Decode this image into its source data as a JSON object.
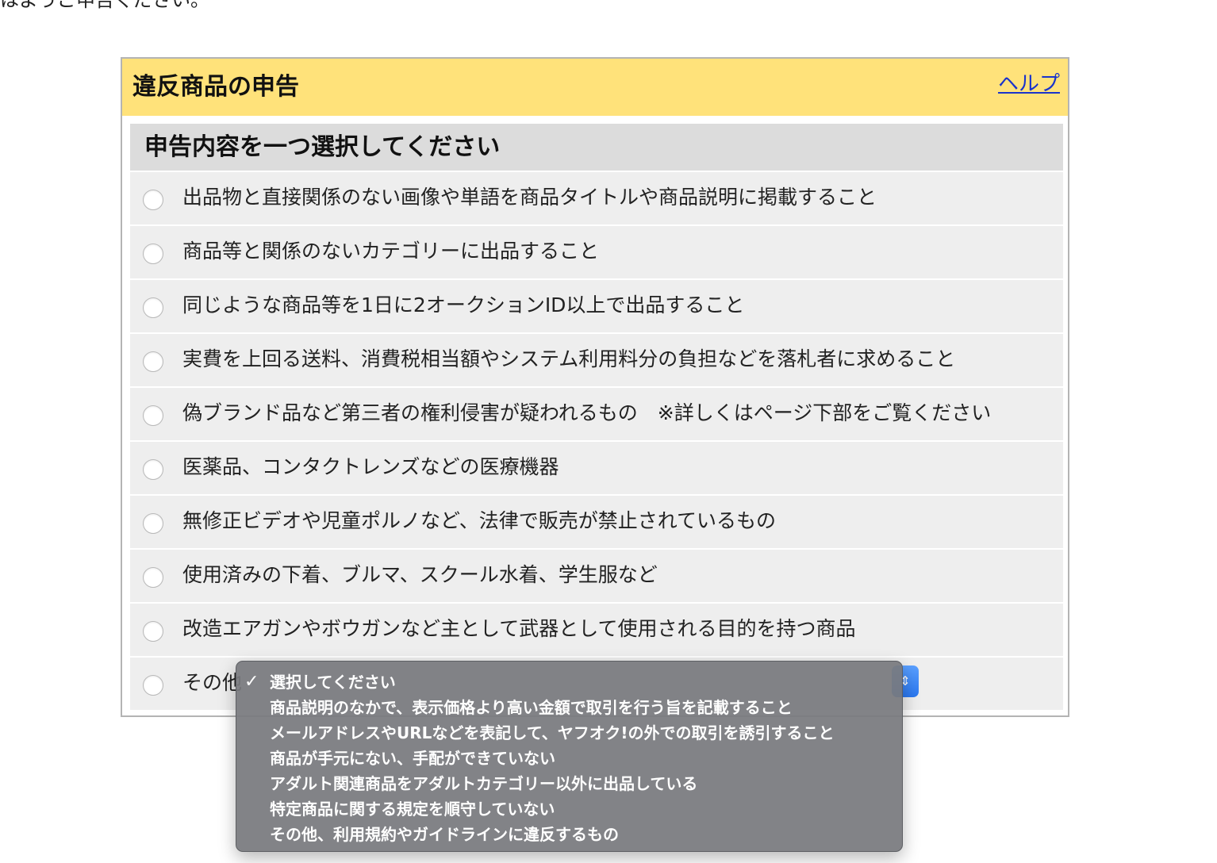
{
  "page": {
    "top_text": "はようご申告ください。"
  },
  "panel": {
    "title": "違反商品の申告",
    "help_label": "ヘルプ"
  },
  "form": {
    "heading": "申告内容を一つ選択してください",
    "options": [
      {
        "label": "出品物と直接関係のない画像や単語を商品タイトルや商品説明に掲載すること"
      },
      {
        "label": "商品等と関係のないカテゴリーに出品すること"
      },
      {
        "label": "同じような商品等を1日に2オークションID以上で出品すること"
      },
      {
        "label": "実費を上回る送料、消費税相当額やシステム利用料分の負担などを落札者に求めること"
      },
      {
        "label": "偽ブランド品など第三者の権利侵害が疑われるもの　※詳しくはページ下部をご覧ください"
      },
      {
        "label": "医薬品、コンタクトレンズなどの医療機器"
      },
      {
        "label": "無修正ビデオや児童ポルノなど、法律で販売が禁止されているもの"
      },
      {
        "label": "使用済みの下着、ブルマ、スクール水着、学生服など"
      },
      {
        "label": "改造エアガンやボウガンなど主として武器として使用される目的を持つ商品"
      },
      {
        "label": "その他"
      }
    ]
  },
  "dropdown": {
    "check_glyph": "✓",
    "options": [
      {
        "label": "選択してください",
        "selected": true
      },
      {
        "label": "商品説明のなかで、表示価格より高い金額で取引を行う旨を記載すること",
        "selected": false
      },
      {
        "label": "メールアドレスやURLなどを表記して、ヤフオク!の外での取引を誘引すること",
        "selected": false
      },
      {
        "label": "商品が手元にない、手配ができていない",
        "selected": false
      },
      {
        "label": "アダルト関連商品をアダルトカテゴリー以外に出品している",
        "selected": false
      },
      {
        "label": "特定商品に関する規定を順守していない",
        "selected": false
      },
      {
        "label": "その他、利用規約やガイドラインに違反するもの",
        "selected": false
      }
    ]
  },
  "colors": {
    "header_bg": "#ffe27a",
    "link": "#1a33cc",
    "row_bg": "#eeeeee",
    "heading_bg": "#dcdcdc"
  }
}
